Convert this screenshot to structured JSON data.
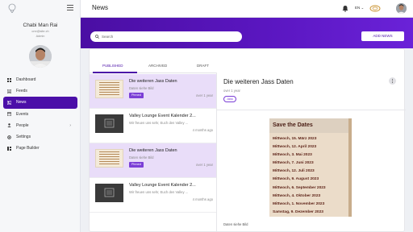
{
  "sidebar": {
    "profile": {
      "name": "Chabi Man Rai",
      "email": "cmr@site.ch",
      "role": "Admin"
    },
    "items": [
      {
        "label": "Dashboard",
        "icon": "grid-icon"
      },
      {
        "label": "Feeds",
        "icon": "feed-icon"
      },
      {
        "label": "News",
        "icon": "news-icon",
        "active": true
      },
      {
        "label": "Events",
        "icon": "calendar-icon"
      },
      {
        "label": "People",
        "icon": "people-icon",
        "chevron": "›"
      },
      {
        "label": "Settings",
        "icon": "gear-icon"
      },
      {
        "label": "Page Builder",
        "icon": "builder-icon"
      }
    ]
  },
  "header": {
    "title": "News",
    "language": "EN"
  },
  "toolbar": {
    "search_placeholder": "Search",
    "add_label": "ADD NEWS"
  },
  "tabs": [
    "PUBLISHED",
    "ARCHIVED",
    "DRAFT"
  ],
  "news_list": [
    {
      "title": "Die weiteren Jass Daten",
      "subtitle": "Daten siehe Bild",
      "badge": "Pinned",
      "time": "over 1 year",
      "thumb": "image",
      "selected": true
    },
    {
      "title": "Valley Lounge Event Kalender 2...",
      "subtitle": "Wir freuen uns sehr, Euch den Valley ...",
      "badge": "",
      "time": "4 months ago",
      "thumb": "dark",
      "selected": false
    },
    {
      "title": "Die weiteren Jass Daten",
      "subtitle": "Daten siehe Bild",
      "badge": "Pinned",
      "time": "over 1 year",
      "thumb": "image",
      "selected": true
    },
    {
      "title": "Valley Lounge Event Kalender 2...",
      "subtitle": "Wir freuen uns sehr, Euch den Valley ...",
      "badge": "",
      "time": "4 months ago",
      "thumb": "dark",
      "selected": false
    }
  ],
  "detail": {
    "title": "Die weiteren Jass Daten",
    "time": "over 1 year",
    "chip": "Jass",
    "poster_heading": "Save the Dates",
    "dates": [
      "Mittwoch, 15. März 2023",
      "Mittwoch, 12. April 2023",
      "Mittwoch, 3. Mai 2023",
      "Mittwoch, 7. Juni 2023",
      "Mittwoch, 12. Juli 2023",
      "Mittwoch, 9. August 2023",
      "Mittwoch, 6. September 2023",
      "Mittwoch, 4. Oktober 2023",
      "Mittwoch, 1. November 2023",
      "Samstag, 9. Dezember 2023"
    ],
    "caption": "Daten siehe Bild"
  },
  "colors": {
    "accent": "#4b0fa8",
    "selected_row": "#e9ddf9",
    "badge": "#7b3fd6"
  }
}
